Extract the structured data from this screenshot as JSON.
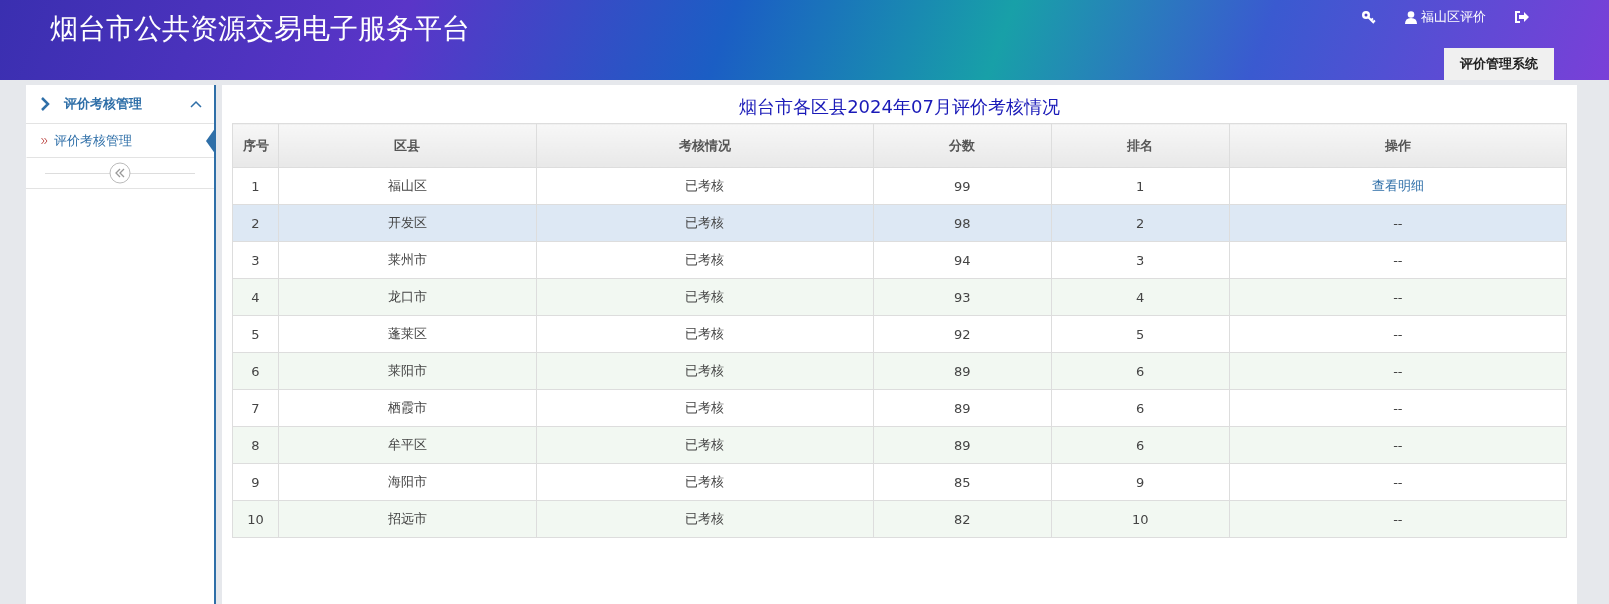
{
  "header": {
    "title": "烟台市公共资源交易电子服务平台",
    "user": "福山区评价",
    "system_tab": "评价管理系统"
  },
  "sidebar": {
    "group": {
      "label": "评价考核管理",
      "expanded": true
    },
    "items": [
      {
        "label": "评价考核管理",
        "selected": true
      }
    ]
  },
  "report": {
    "title": "烟台市各区县2024年07月评价考核情况",
    "columns": [
      "序号",
      "区县",
      "考核情况",
      "分数",
      "排名",
      "操作"
    ],
    "rows": [
      {
        "no": "1",
        "district": "福山区",
        "status": "已考核",
        "score": "99",
        "rank": "1",
        "action": {
          "kind": "link",
          "text": "查看明细"
        },
        "selected": false
      },
      {
        "no": "2",
        "district": "开发区",
        "status": "已考核",
        "score": "98",
        "rank": "2",
        "action": {
          "kind": "text",
          "text": "--"
        },
        "selected": true
      },
      {
        "no": "3",
        "district": "莱州市",
        "status": "已考核",
        "score": "94",
        "rank": "3",
        "action": {
          "kind": "text",
          "text": "--"
        },
        "selected": false
      },
      {
        "no": "4",
        "district": "龙口市",
        "status": "已考核",
        "score": "93",
        "rank": "4",
        "action": {
          "kind": "text",
          "text": "--"
        },
        "selected": false
      },
      {
        "no": "5",
        "district": "蓬莱区",
        "status": "已考核",
        "score": "92",
        "rank": "5",
        "action": {
          "kind": "text",
          "text": "--"
        },
        "selected": false
      },
      {
        "no": "6",
        "district": "莱阳市",
        "status": "已考核",
        "score": "89",
        "rank": "6",
        "action": {
          "kind": "text",
          "text": "--"
        },
        "selected": false
      },
      {
        "no": "7",
        "district": "栖霞市",
        "status": "已考核",
        "score": "89",
        "rank": "6",
        "action": {
          "kind": "text",
          "text": "--"
        },
        "selected": false
      },
      {
        "no": "8",
        "district": "牟平区",
        "status": "已考核",
        "score": "89",
        "rank": "6",
        "action": {
          "kind": "text",
          "text": "--"
        },
        "selected": false
      },
      {
        "no": "9",
        "district": "海阳市",
        "status": "已考核",
        "score": "85",
        "rank": "9",
        "action": {
          "kind": "text",
          "text": "--"
        },
        "selected": false
      },
      {
        "no": "10",
        "district": "招远市",
        "status": "已考核",
        "score": "82",
        "rank": "10",
        "action": {
          "kind": "text",
          "text": "--"
        },
        "selected": false
      }
    ]
  }
}
